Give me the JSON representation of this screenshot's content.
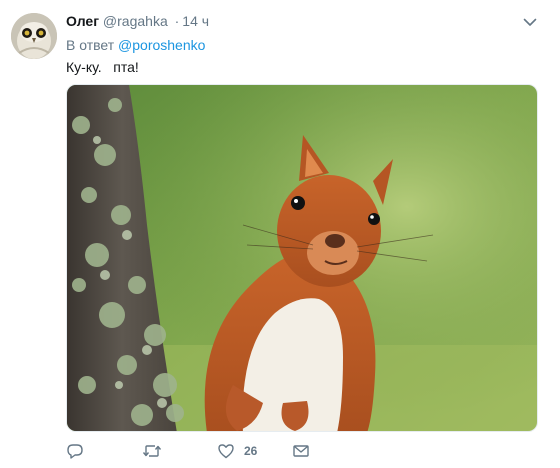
{
  "tweet": {
    "author_name": "Олег",
    "author_handle": "@ragahka",
    "separator": "·",
    "time": "14 ч",
    "reply_prefix": "В ответ",
    "reply_mention": "@poroshenko",
    "text": "Ку-ку.   пта!",
    "media_subject": "red squirrel behind a lichen-covered tree trunk"
  },
  "actions": {
    "reply_icon": "reply-icon",
    "retweet_icon": "retweet-icon",
    "like_icon": "heart-icon",
    "like_count": "26",
    "dm_icon": "envelope-icon"
  },
  "colors": {
    "name": "#14171a",
    "secondary": "#657786",
    "link": "#1b95e0",
    "background": "#ffffff"
  }
}
